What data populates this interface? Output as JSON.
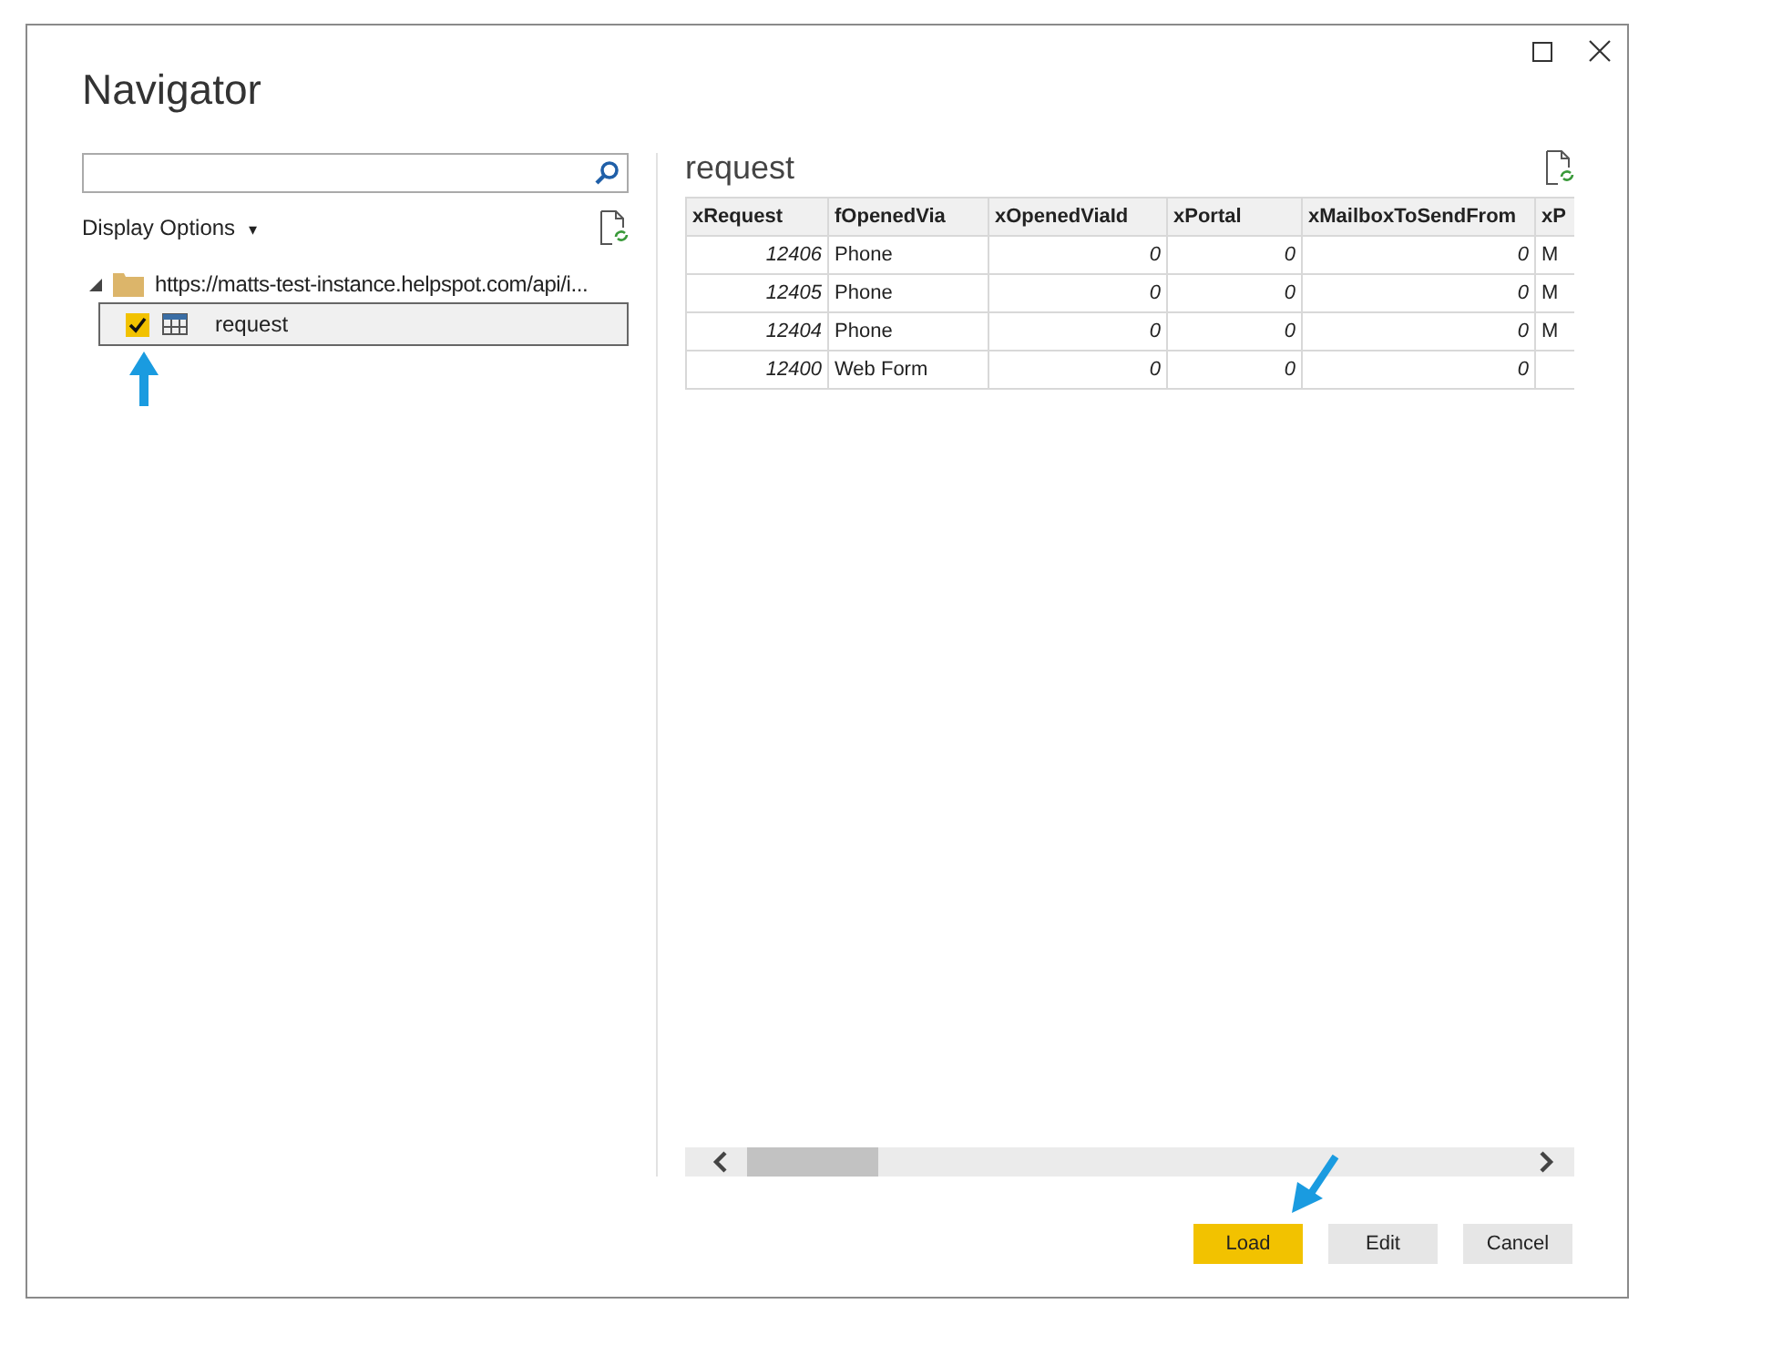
{
  "window": {
    "title": "Navigator"
  },
  "display_options": {
    "label": "Display Options",
    "caret": "▾"
  },
  "tree": [
    {
      "label": "https://matts-test-instance.helpspot.com/api/i...",
      "expanded": true,
      "children": [
        {
          "label": "request",
          "checked": true,
          "selected": true
        }
      ]
    }
  ],
  "preview": {
    "title": "request",
    "table": {
      "columns": [
        "xRequest",
        "fOpenedVia",
        "xOpenedViaId",
        "xPortal",
        "xMailboxToSendFrom",
        "xP"
      ],
      "rows": [
        [
          "12406",
          "Phone",
          "0",
          "0",
          "0",
          "M"
        ],
        [
          "12405",
          "Phone",
          "0",
          "0",
          "0",
          "M"
        ],
        [
          "12404",
          "Phone",
          "0",
          "0",
          "0",
          "M"
        ],
        [
          "12400",
          "Web Form",
          "0",
          "0",
          "0",
          ""
        ]
      ]
    }
  },
  "buttons": [
    {
      "label": "Load",
      "kind": "primary"
    },
    {
      "label": "Edit",
      "kind": "secondary"
    },
    {
      "label": "Cancel",
      "kind": "secondary"
    }
  ]
}
